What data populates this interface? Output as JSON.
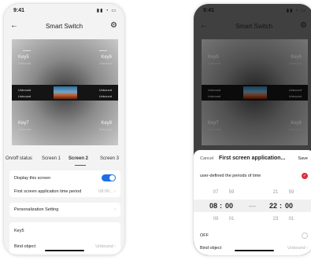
{
  "status_bar": {
    "time": "9:41",
    "icons": "signal wifi battery"
  },
  "header": {
    "title": "Smart Switch",
    "back_icon": "arrow-left-icon",
    "settings_icon": "gear-icon"
  },
  "panel": {
    "keys": {
      "tl": {
        "name": "Key5",
        "status": "Unbound"
      },
      "tr": {
        "name": "Key6",
        "status": "Unbound"
      },
      "bl": {
        "name": "Key7",
        "status": "Unbound"
      },
      "br": {
        "name": "Key8",
        "status": "Unbound"
      }
    },
    "screen_labels": [
      "Unbound",
      "Unbound",
      "Unbound",
      "Unbound"
    ]
  },
  "tabs": [
    "On/off status",
    "Screen 1",
    "Screen 2",
    "Screen 3"
  ],
  "active_tab_index": 2,
  "settings": {
    "display_screen": {
      "label": "Display this screen",
      "enabled": true
    },
    "time_period": {
      "label": "First screen application time period",
      "value": "08:00..."
    },
    "personalization": {
      "label": "Personalization Setting"
    },
    "key_section": {
      "title": "Key5"
    },
    "bind_object": {
      "label": "Bind object",
      "value": "Unbound"
    }
  },
  "sheet": {
    "cancel": "Cancel",
    "title": "First screen application...",
    "save": "Save",
    "option_label": "user-defined the periods of time",
    "picker": {
      "start": {
        "hour_prev": "07",
        "min_prev": "59",
        "hour": "08",
        "min": "00",
        "hour_next": "09",
        "min_next": "01"
      },
      "end": {
        "hour_prev": "21",
        "min_prev": "59",
        "hour": "22",
        "min": "00",
        "hour_next": "23",
        "min_next": "01"
      },
      "separator": "—"
    },
    "off_label": "OFF"
  },
  "colors": {
    "accent_blue": "#1e6fe6",
    "accent_red": "#e22b3c",
    "tab_underline": "#e02020"
  }
}
